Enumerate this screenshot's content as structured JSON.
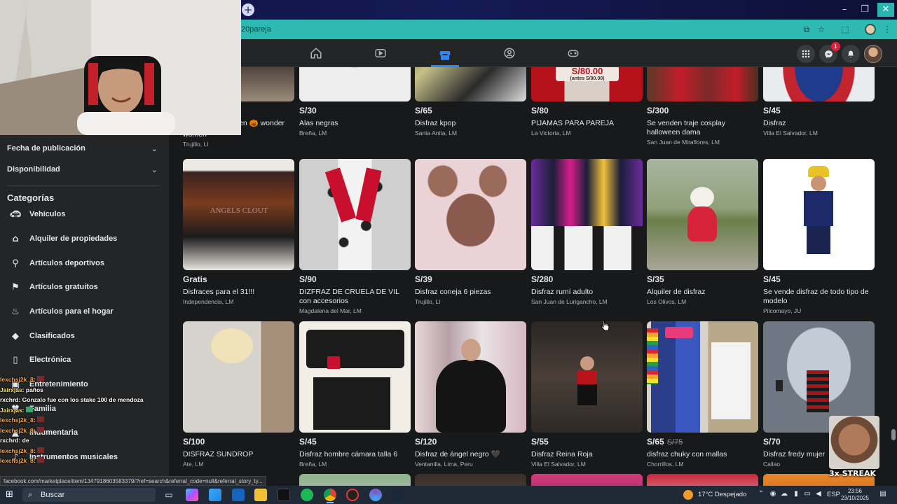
{
  "browser": {
    "url_fragment": "20pareja",
    "status_url": "facebook.com/marketplace/item/1347918603583379/?ref=search&referral_code=null&referral_story_ty..."
  },
  "sidebar": {
    "filters": [
      {
        "label": "Fecha de publicación"
      },
      {
        "label": "Disponibilidad"
      }
    ],
    "categories_heading": "Categorías",
    "categories": [
      {
        "label": "Vehículos",
        "icon": "car-icon"
      },
      {
        "label": "Alquiler de propiedades",
        "icon": "house-icon"
      },
      {
        "label": "Artículos deportivos",
        "icon": "sports-icon"
      },
      {
        "label": "Artículos gratuitos",
        "icon": "tag-icon"
      },
      {
        "label": "Artículos para el hogar",
        "icon": "home-goods-icon"
      },
      {
        "label": "Clasificados",
        "icon": "classified-icon"
      },
      {
        "label": "Electrónica",
        "icon": "phone-icon"
      },
      {
        "label": "Entretenimiento",
        "icon": "entertainment-icon"
      },
      {
        "label": "Familia",
        "icon": "family-icon"
      },
      {
        "label": "Indumentaria",
        "icon": "clothing-icon"
      },
      {
        "label": "Instrumentos musicales",
        "icon": "music-icon"
      }
    ]
  },
  "chat": [
    {
      "user": "lexchsj2k_8",
      "msg": ""
    },
    {
      "user": "Jairxjas",
      "msg": "paños"
    },
    {
      "user": "rxchrd",
      "msg": "Gonzalo fue con los stake 100 de mendoza"
    },
    {
      "user": "Jairxjas",
      "msg": ""
    },
    {
      "user": "lexchsj2k_8",
      "msg": ""
    },
    {
      "user": "lexchsj2k_8",
      "msg": ""
    },
    {
      "user": "rxchrd",
      "msg": "de"
    },
    {
      "user": "lexchsj2k_8",
      "msg": ""
    },
    {
      "user": "lexchsj2k_8",
      "msg": ""
    }
  ],
  "listings_row0": [
    {
      "price": "",
      "title": "women",
      "title_prefix": "en 🎃 wonder",
      "location": "Trujillo, LI"
    },
    {
      "price": "S/30",
      "title": "Alas negras",
      "location": "Breña, LM"
    },
    {
      "price": "S/65",
      "title": "Disfraz kpop",
      "location": "Santa Anita, LM"
    },
    {
      "price": "S/80",
      "title": "PIJAMAS PARA PAREJA",
      "location": "La Victoria, LM"
    },
    {
      "price": "S/300",
      "title": "Se venden traje cosplay halloween dama",
      "location": "San Juan de Miraflores, LM"
    },
    {
      "price": "S/45",
      "title": "Disfraz",
      "location": "Villa El Salvador, LM"
    }
  ],
  "listings_row1": [
    {
      "price": "Gratis",
      "title": "Disfraces para el 31!!!",
      "location": "Independencia, LM"
    },
    {
      "price": "S/90",
      "title": "DIZFRAZ DE CRUELA DE VIL con accesorios",
      "location": "Magdalena del Mar, LM"
    },
    {
      "price": "S/39",
      "title": "Disfraz coneja 6 piezas",
      "location": "Trujillo, LI"
    },
    {
      "price": "S/280",
      "title": "Disfraz rumí adulto",
      "location": "San Juan de Lurigancho, LM"
    },
    {
      "price": "S/35",
      "title": "Alquiler de disfraz",
      "location": "Los Olivos, LM"
    },
    {
      "price": "S/45",
      "title": "Se vende disfraz de todo tipo de modelo",
      "location": "Pilcomayo, JU"
    }
  ],
  "listings_row2": [
    {
      "price": "S/100",
      "old_price": "",
      "title": "DISFRAZ SUNDROP",
      "location": "Ate, LM"
    },
    {
      "price": "S/45",
      "old_price": "",
      "title": "Disfraz hombre cámara talla 6",
      "location": "Breña, LM"
    },
    {
      "price": "S/120",
      "old_price": "",
      "title": "Disfraz de ángel negro 🖤",
      "location": "Ventanilla, Lima, Peru"
    },
    {
      "price": "S/55",
      "old_price": "",
      "title": "Disfraz Reina Roja",
      "location": "Villa El Salvador, LM"
    },
    {
      "price": "S/65",
      "old_price": "S/75",
      "title": "disfraz chuky con mallas",
      "location": "Chorrillos, LM"
    },
    {
      "price": "S/70",
      "old_price": "",
      "title": "Disfraz fredy mujer",
      "location": "Callao"
    }
  ],
  "thumb_texts": {
    "pijamas_banner": "S/80.00",
    "pijamas_banner_sub": "(antes S/90.00)",
    "angel_watermark": "ANGELS CLOUT"
  },
  "notifications": {
    "messenger_badge": "1"
  },
  "streak": {
    "label": "3x STREAK"
  },
  "taskbar": {
    "search_placeholder": "Buscar",
    "weather": "17°C  Despejado",
    "lang": "ESP",
    "time": "23:56",
    "date": "23/10/2025"
  }
}
